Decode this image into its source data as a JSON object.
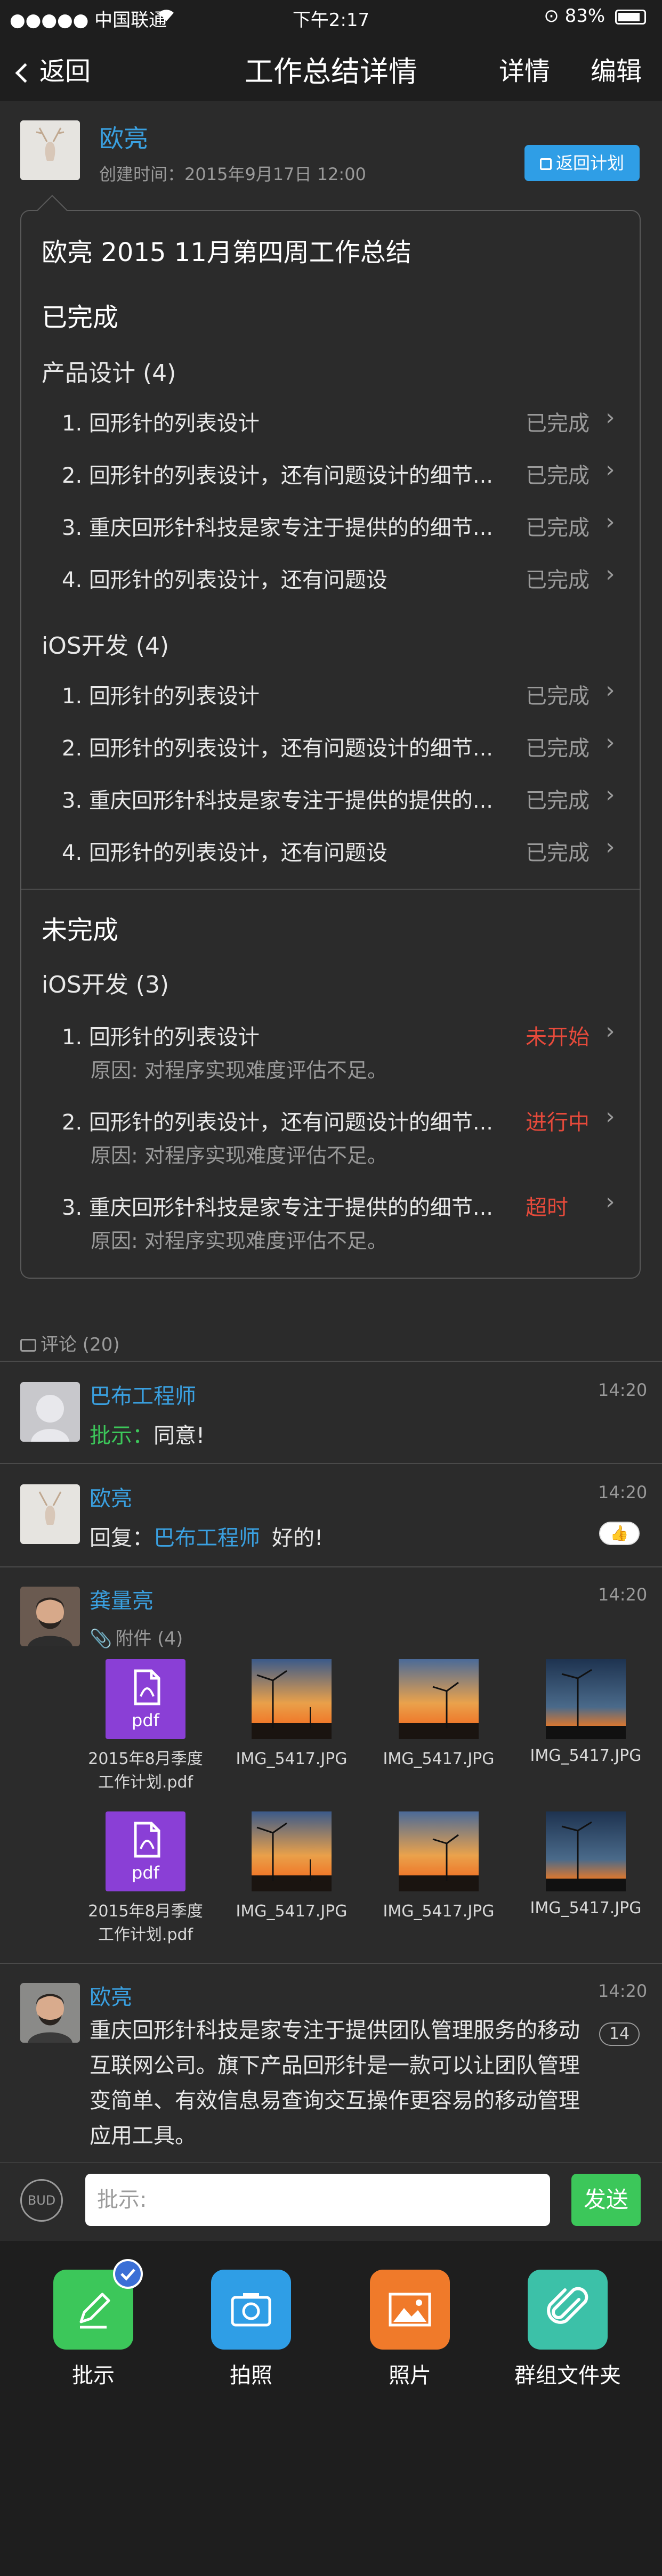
{
  "status": {
    "carrier": "●●●●● 中国联通",
    "time": "下午2:17",
    "battery": "83%"
  },
  "nav": {
    "back": "返回",
    "title": "工作总结详情",
    "detail": "详情",
    "edit": "编辑"
  },
  "header": {
    "author": "欧亮",
    "created": "创建时间：2015年9月17日 12:00",
    "return_plan": "返回计划"
  },
  "summary": {
    "title": "欧亮 2015 11月第四周工作总结",
    "done_label": "已完成",
    "done_groups": [
      {
        "name": "产品设计 (4)",
        "items": [
          {
            "text": "1. 回形针的列表设计",
            "status": "已完成"
          },
          {
            "text": "2. 回形针的列表设计，还有问题设计的细节...",
            "status": "已完成"
          },
          {
            "text": "3. 重庆回形针科技是家专注于提供的的细节...",
            "status": "已完成"
          },
          {
            "text": "4. 回形针的列表设计，还有问题设",
            "status": "已完成"
          }
        ]
      },
      {
        "name": "iOS开发 (4)",
        "items": [
          {
            "text": "1. 回形针的列表设计",
            "status": "已完成"
          },
          {
            "text": "2. 回形针的列表设计，还有问题设计的细节...",
            "status": "已完成"
          },
          {
            "text": "3. 重庆回形针科技是家专注于提供的提供的...",
            "status": "已完成"
          },
          {
            "text": "4. 回形针的列表设计，还有问题设",
            "status": "已完成"
          }
        ]
      }
    ],
    "undone_label": "未完成",
    "undone_group": {
      "name": "iOS开发 (3)",
      "items": [
        {
          "text": "1. 回形针的列表设计",
          "status": "未开始",
          "reason": "原因:  对程序实现难度评估不足。"
        },
        {
          "text": "2. 回形针的列表设计，还有问题设计的细节...",
          "status": "进行中",
          "reason": "原因:  对程序实现难度评估不足。"
        },
        {
          "text": "3. 重庆回形针科技是家专注于提供的的细节...",
          "status": "超时",
          "reason": "原因:  对程序实现难度评估不足。"
        }
      ]
    }
  },
  "comments": {
    "header": "评论 (20)",
    "list": [
      {
        "name": "巴布工程师",
        "time": "14:20",
        "prefix": "批示：",
        "text": "同意!"
      },
      {
        "name": "欧亮",
        "time": "14:20",
        "prefix": "回复：",
        "mention": "巴布工程师",
        "text": "好的!"
      },
      {
        "name": "龚量亮",
        "time": "14:20",
        "attach_label": "附件 (4)",
        "files": [
          "2015年8月季度工作计划.pdf",
          "IMG_5417.JPG",
          "IMG_5417.JPG",
          "IMG_5417.JPG",
          "2015年8月季度工作计划.pdf",
          "IMG_5417.JPG",
          "IMG_5417.JPG",
          "IMG_5417.JPG"
        ],
        "pdf_label": "pdf"
      },
      {
        "name": "欧亮",
        "time": "14:20",
        "text": "重庆回形针科技是家专注于提供团队管理服务的移动互联网公司。旗下产品回形针是一款可以让团队管理变简单、有效信息易查询交互操作更容易的移动管理应用工具。",
        "badge": "14"
      }
    ]
  },
  "input": {
    "placeholder": "批示:",
    "send": "发送",
    "emoji_label": "BUD"
  },
  "tools": [
    {
      "label": "批示",
      "color": "#3cc75a"
    },
    {
      "label": "拍照",
      "color": "#2f9ee6"
    },
    {
      "label": "照片",
      "color": "#f07a2a"
    },
    {
      "label": "群组文件夹",
      "color": "#3cc1a8"
    }
  ]
}
